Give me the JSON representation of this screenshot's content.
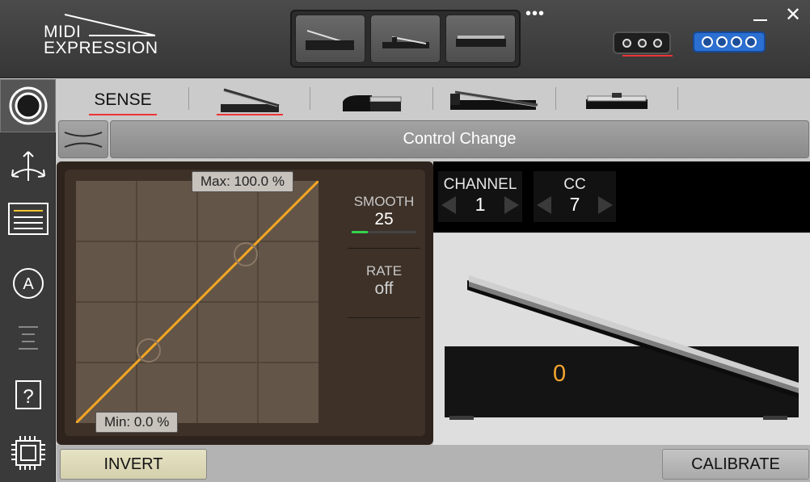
{
  "app": {
    "logo_line1": "MIDI",
    "logo_line2": "EXPRESSION"
  },
  "header": {
    "menu_dots": "•••",
    "close_glyph": "✕",
    "preset_buttons": [
      "pedal-preset-1",
      "pedal-preset-2",
      "pedal-preset-3"
    ]
  },
  "tabs": [
    {
      "label": "SENSE",
      "active": true
    },
    {
      "label": "",
      "icon": "expression-pedal-icon",
      "active": true
    },
    {
      "label": "",
      "icon": "sustain-pedal-icon"
    },
    {
      "label": "",
      "icon": "long-pedal-icon"
    },
    {
      "label": "",
      "icon": "footswitch-icon"
    }
  ],
  "mode": {
    "label": "Control Change"
  },
  "curve": {
    "max_label": "Max: 100.0 %",
    "min_label": "Min: 0.0 %",
    "max_percent": 100.0,
    "min_percent": 0.0,
    "line_color": "#f5a623"
  },
  "params": {
    "smooth_label": "SMOOTH",
    "smooth_value": "25",
    "smooth_level": 0.25,
    "rate_label": "RATE",
    "rate_value": "off"
  },
  "midi": {
    "channel_label": "CHANNEL",
    "channel_value": "1",
    "cc_label": "CC",
    "cc_value": "7"
  },
  "pedal": {
    "value": "0",
    "value_color": "#f4a52f"
  },
  "buttons": {
    "invert": "INVERT",
    "calibrate": "CALIBRATE"
  },
  "sidebar": {
    "items": [
      "record-icon",
      "routing-arrows-icon",
      "list-icon",
      "auto-icon",
      "levels-icon",
      "help-icon",
      "chip-icon"
    ],
    "help_glyph": "?",
    "auto_glyph": "A"
  },
  "colors": {
    "accent_red": "#e33333",
    "accent_blue": "#2b6fd1",
    "smooth_bar": "#34d24b"
  }
}
